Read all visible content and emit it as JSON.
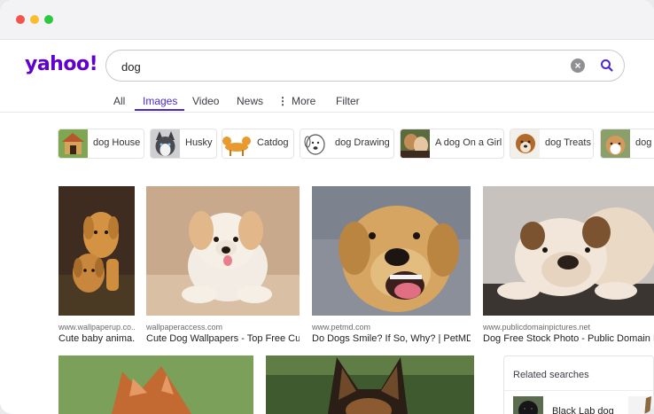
{
  "window": {
    "traffic_lights": {
      "close": "#f4544c",
      "minimize": "#fbbd2e",
      "zoom": "#2cc840"
    }
  },
  "brand": {
    "logo_text": "yahoo!",
    "color": "#6001d2"
  },
  "search": {
    "value": "dog",
    "clear_icon": "clear-icon",
    "submit_icon": "search-icon",
    "accent": "#4a29d4"
  },
  "tabs": [
    {
      "label": "All"
    },
    {
      "label": "Images",
      "active": true
    },
    {
      "label": "Video"
    },
    {
      "label": "News"
    },
    {
      "label": "More",
      "icon": "more-vertical-icon"
    },
    {
      "label": "Filter"
    }
  ],
  "suggestions": [
    {
      "label": "dog House"
    },
    {
      "label": "Husky"
    },
    {
      "label": "Catdog"
    },
    {
      "label": "dog Drawing"
    },
    {
      "label": "A dog On a Girl"
    },
    {
      "label": "dog Treats"
    },
    {
      "label": "dog"
    }
  ],
  "results": [
    {
      "source": "www.wallpaperup.co...",
      "title": "Cute baby anima..."
    },
    {
      "source": "wallpaperaccess.com",
      "title": "Cute Dog Wallpapers - Top Free Cut..."
    },
    {
      "source": "www.petmd.com",
      "title": "Do Dogs Smile? If So, Why? | PetMD"
    },
    {
      "source": "www.publicdomainpictures.net",
      "title": "Dog Free Stock Photo - Public Domain Pi..."
    }
  ],
  "related": {
    "header": "Related searches",
    "items": [
      {
        "label": "Black Lab dog"
      }
    ]
  }
}
